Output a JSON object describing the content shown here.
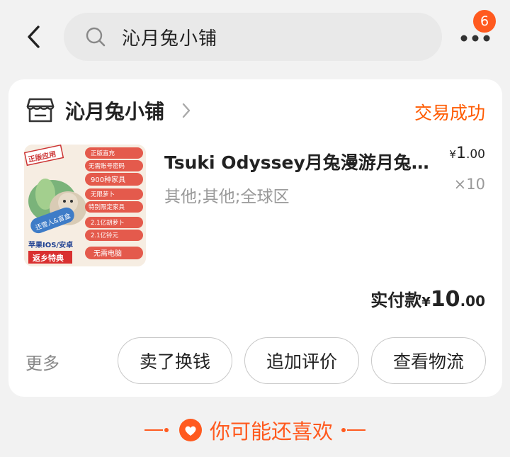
{
  "header": {
    "search_text": "沁月兔小铺",
    "notification_count": "6"
  },
  "order": {
    "store_name": "沁月兔小铺",
    "status": "交易成功",
    "product": {
      "title": "Tsuki Odyssey月兔漫游月兔奥...",
      "spec": "其他;其他;全球区",
      "price_symbol": "¥",
      "price_int": "1",
      "price_dec": ".00",
      "quantity": "×10",
      "image_texts": [
        "正版应用",
        "正版直充",
        "无需账号密码",
        "900种家具",
        "无限萝卜",
        "特别限定家具",
        "2.1亿胡萝卜",
        "2.1亿铃元",
        "还雪人&盲盒",
        "苹果IOS/安卓",
        "返乡特典",
        "无需电脑"
      ]
    },
    "paid_label": "实付款",
    "paid_symbol": "¥",
    "paid_int": "10",
    "paid_dec": ".00",
    "more_label": "更多",
    "actions": [
      "卖了换钱",
      "追加评价",
      "查看物流"
    ]
  },
  "recommend": {
    "title": "你可能还喜欢"
  },
  "colors": {
    "accent": "#ff5a1f",
    "status": "#ff5a00",
    "card_bg": "#ffffff",
    "page_bg": "#f2f2f2"
  }
}
